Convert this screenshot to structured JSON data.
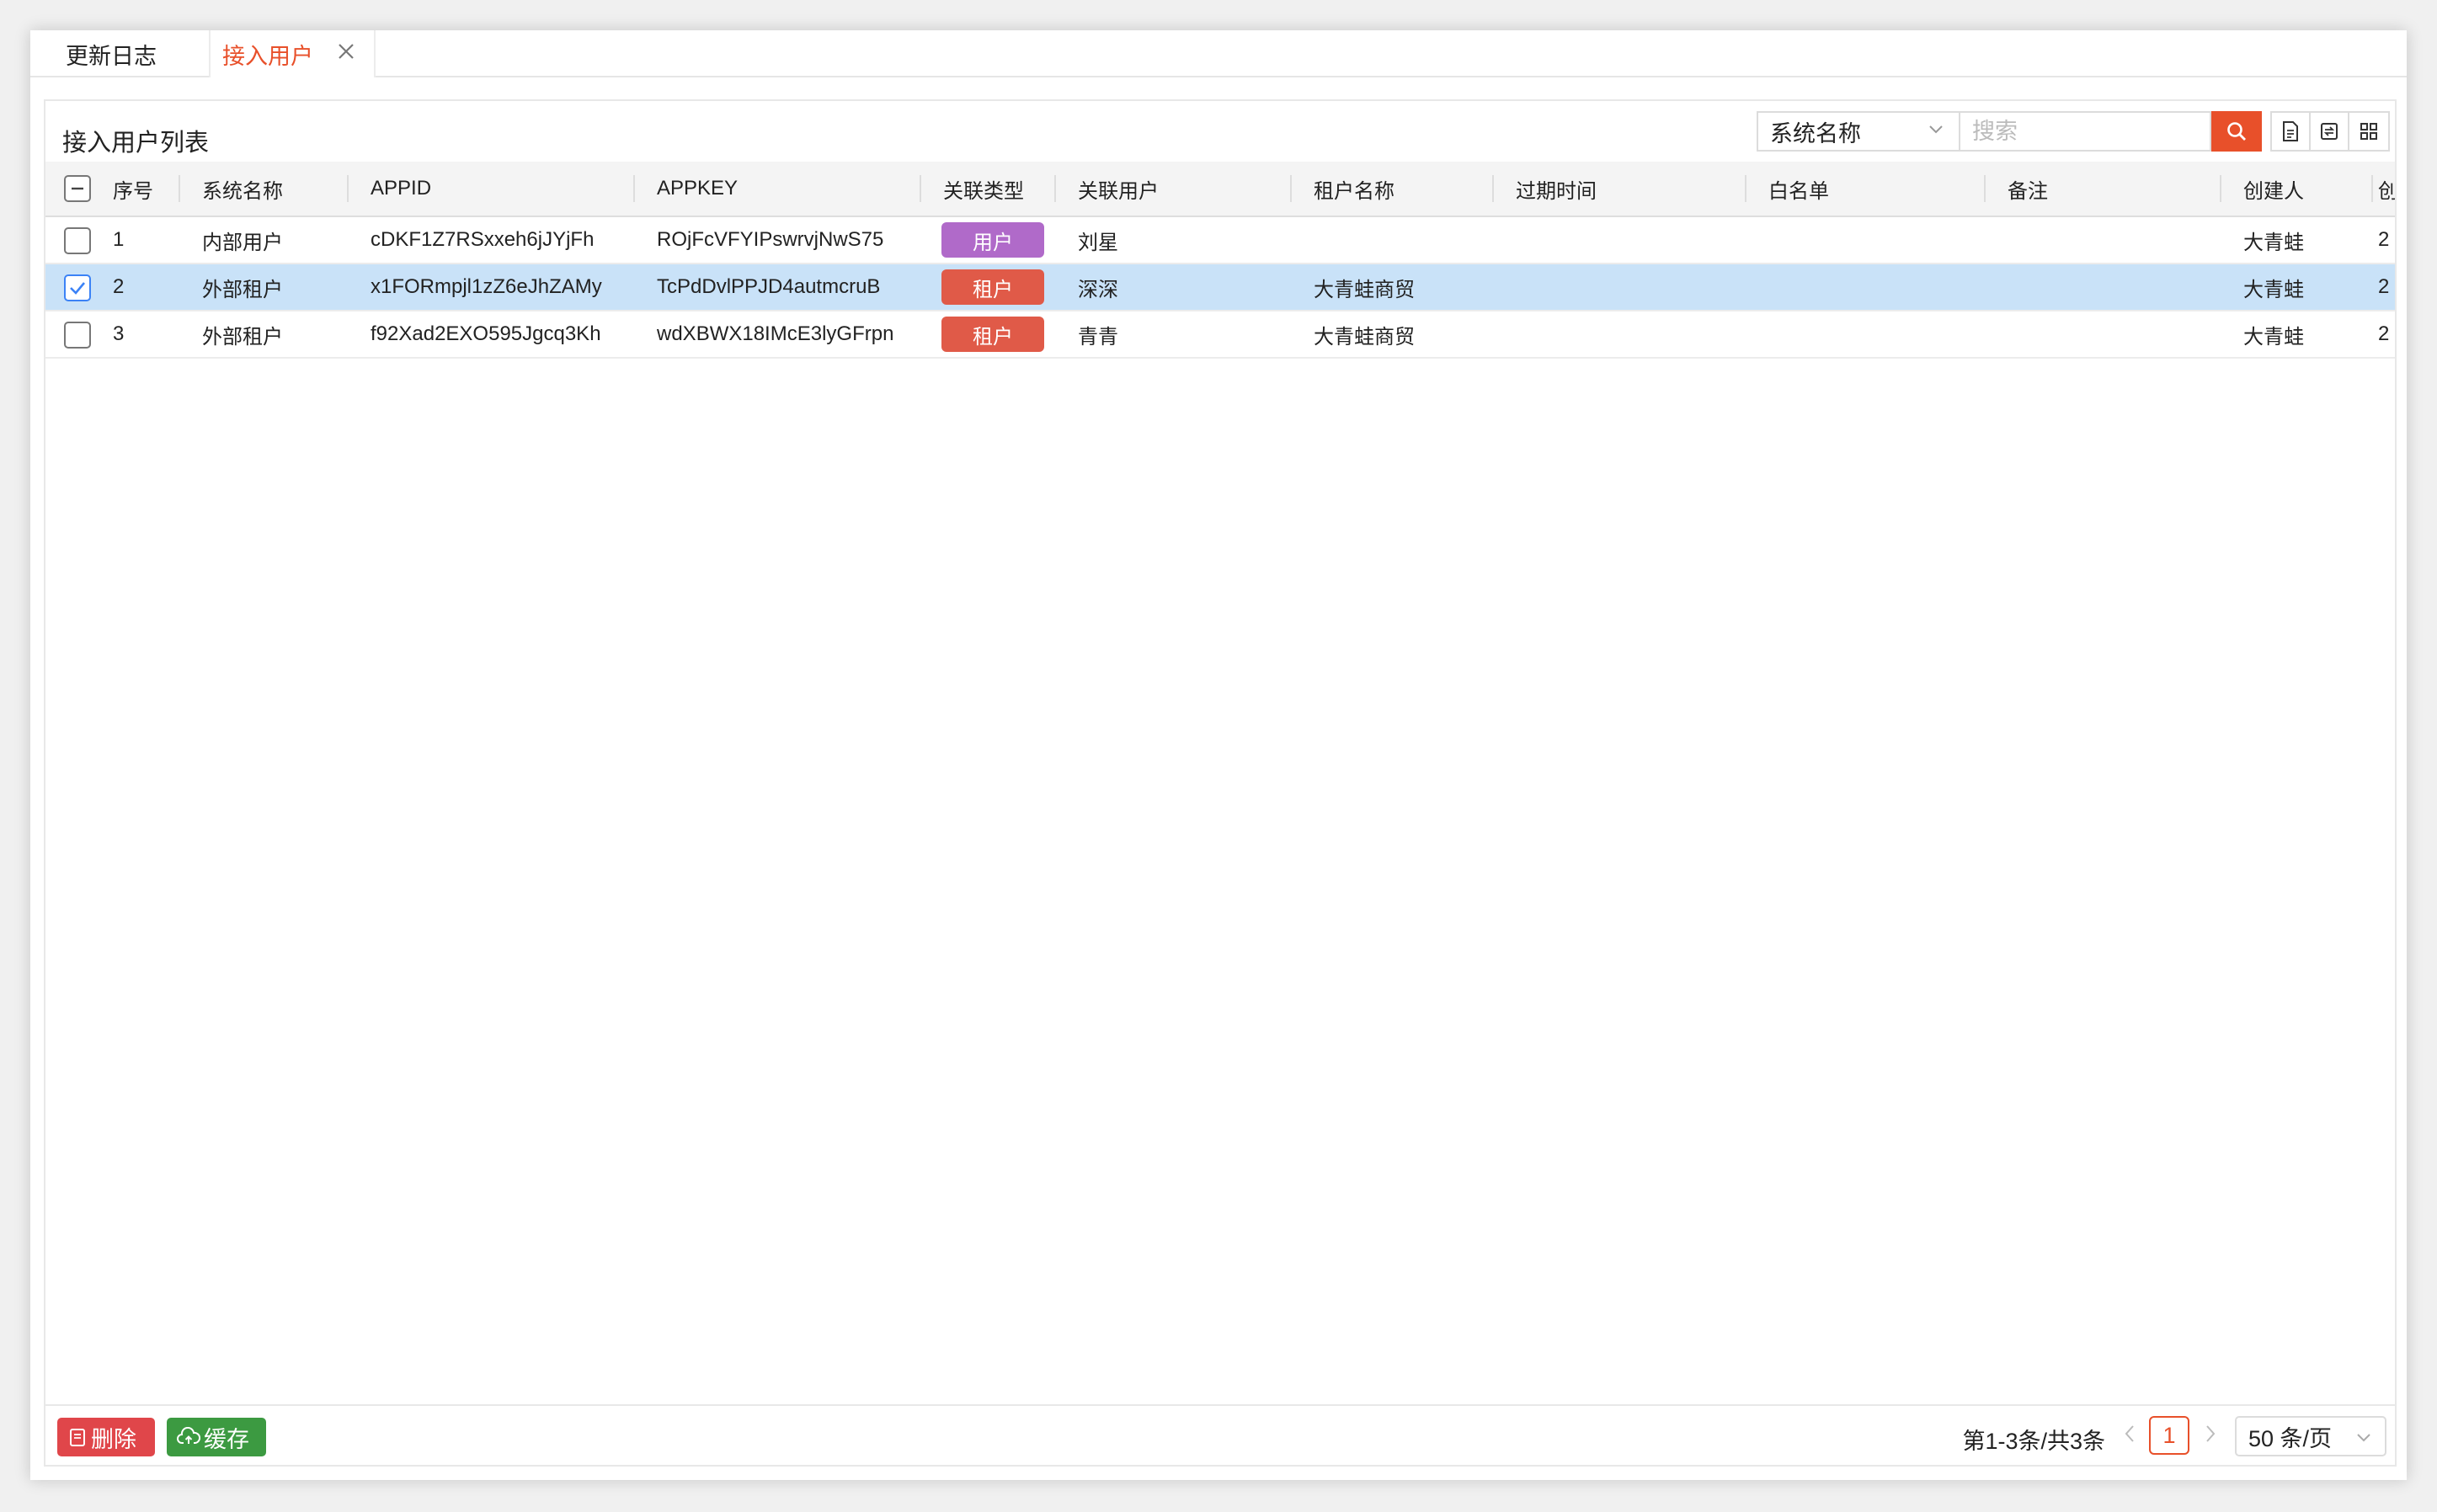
{
  "tabs": [
    {
      "label": "更新日志"
    },
    {
      "label": "接入用户"
    }
  ],
  "panel": {
    "title": "接入用户列表",
    "filter_select": "系统名称",
    "search_placeholder": "搜索"
  },
  "columns": [
    "序号",
    "系统名称",
    "APPID",
    "APPKEY",
    "关联类型",
    "关联用户",
    "租户名称",
    "过期时间",
    "白名单",
    "备注",
    "创建人",
    "创"
  ],
  "rows": [
    {
      "no": "1",
      "system": "内部用户",
      "appid": "cDKF1Z7RSxxeh6jJYjFh",
      "appkey": "ROjFcVFYIPswrvjNwS75",
      "type": "用户",
      "type_color": "#b06ac9",
      "user": "刘星",
      "tenant": "",
      "expire": "",
      "whitelist": "",
      "remark": "",
      "creator": "大青蛙",
      "created_trunc": "2",
      "selected": false
    },
    {
      "no": "2",
      "system": "外部租户",
      "appid": "x1FORmpjl1zZ6eJhZAMy",
      "appkey": "TcPdDvlPPJD4autmcruB",
      "type": "租户",
      "type_color": "#e05a48",
      "user": "深深",
      "tenant": "大青蛙商贸",
      "expire": "",
      "whitelist": "",
      "remark": "",
      "creator": "大青蛙",
      "created_trunc": "2",
      "selected": true
    },
    {
      "no": "3",
      "system": "外部租户",
      "appid": "f92Xad2EXO595Jgcq3Kh",
      "appkey": "wdXBWX18IMcE3lyGFrpn",
      "type": "租户",
      "type_color": "#e05a48",
      "user": "青青",
      "tenant": "大青蛙商贸",
      "expire": "",
      "whitelist": "",
      "remark": "",
      "creator": "大青蛙",
      "created_trunc": "2",
      "selected": false
    }
  ],
  "footer": {
    "delete_label": "删除",
    "cache_label": "缓存",
    "pager_info": "第1-3条/共3条",
    "current_page": "1",
    "page_size": "50 条/页"
  },
  "colors": {
    "accent": "#e8502a",
    "selected_row": "#c9e2f8",
    "delete_button": "#e0464a",
    "cache_button": "#3c9a41",
    "badge_user": "#b06ac9",
    "badge_tenant": "#e05a48"
  }
}
